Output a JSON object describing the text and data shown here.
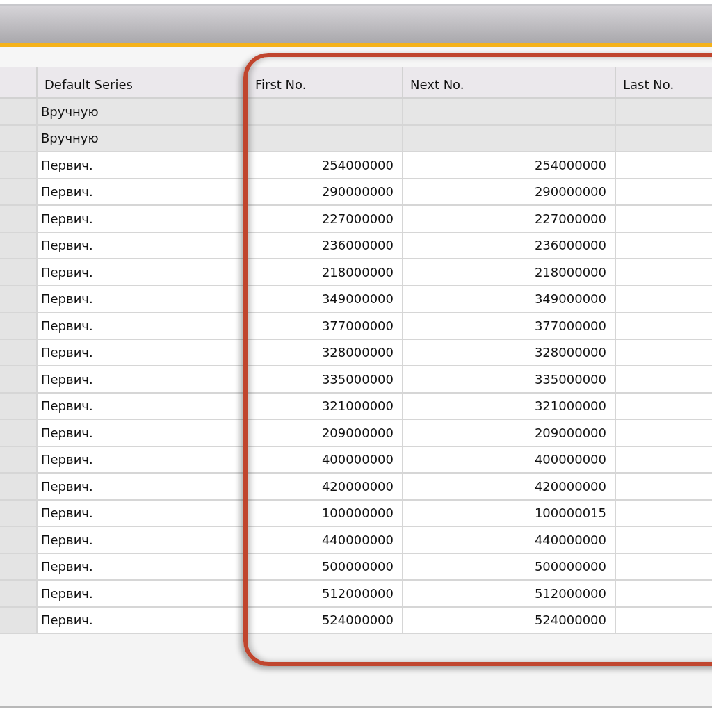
{
  "table": {
    "columns": [
      "Default Series",
      "First No.",
      "Next No.",
      "Last No."
    ],
    "rows": [
      {
        "disabled": true,
        "default_series": "Вручную"
      },
      {
        "disabled": true,
        "default_series": "Вручную"
      },
      {
        "disabled": false,
        "default_series": "Первич.",
        "first_no": "254000000",
        "next_no": "254000000"
      },
      {
        "disabled": false,
        "default_series": "Первич.",
        "first_no": "290000000",
        "next_no": "290000000"
      },
      {
        "disabled": false,
        "default_series": "Первич.",
        "first_no": "227000000",
        "next_no": "227000000"
      },
      {
        "disabled": false,
        "default_series": "Первич.",
        "first_no": "236000000",
        "next_no": "236000000"
      },
      {
        "disabled": false,
        "default_series": "Первич.",
        "first_no": "218000000",
        "next_no": "218000000"
      },
      {
        "disabled": false,
        "default_series": "Первич.",
        "first_no": "349000000",
        "next_no": "349000000"
      },
      {
        "disabled": false,
        "default_series": "Первич.",
        "first_no": "377000000",
        "next_no": "377000000"
      },
      {
        "disabled": false,
        "default_series": "Первич.",
        "first_no": "328000000",
        "next_no": "328000000"
      },
      {
        "disabled": false,
        "default_series": "Первич.",
        "first_no": "335000000",
        "next_no": "335000000"
      },
      {
        "disabled": false,
        "default_series": "Первич.",
        "first_no": "321000000",
        "next_no": "321000000"
      },
      {
        "disabled": false,
        "default_series": "Первич.",
        "first_no": "209000000",
        "next_no": "209000000"
      },
      {
        "disabled": false,
        "default_series": "Первич.",
        "first_no": "400000000",
        "next_no": "400000000"
      },
      {
        "disabled": false,
        "default_series": "Первич.",
        "first_no": "420000000",
        "next_no": "420000000"
      },
      {
        "disabled": false,
        "default_series": "Первич.",
        "first_no": "100000000",
        "next_no": "100000015"
      },
      {
        "disabled": false,
        "default_series": "Первич.",
        "first_no": "440000000",
        "next_no": "440000000"
      },
      {
        "disabled": false,
        "default_series": "Первич.",
        "first_no": "500000000",
        "next_no": "500000000"
      },
      {
        "disabled": false,
        "default_series": "Первич.",
        "first_no": "512000000",
        "next_no": "512000000"
      },
      {
        "disabled": false,
        "default_series": "Первич.",
        "first_no": "524000000",
        "next_no": "524000000"
      }
    ]
  }
}
